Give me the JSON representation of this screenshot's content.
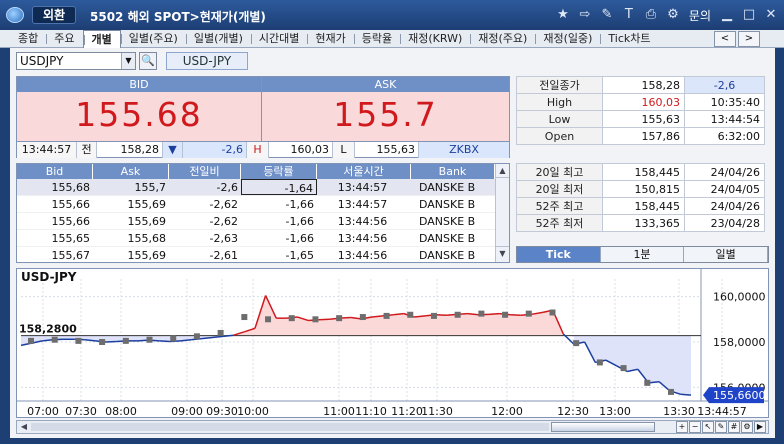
{
  "titlebar": {
    "badge": "외환",
    "title": "5502 해외 SPOT>현재가(개별)",
    "help_label": "문의",
    "icons": [
      "star-icon",
      "export-icon",
      "tool-icon",
      "text-icon",
      "print-icon",
      "settings-icon",
      "minimize-icon",
      "maximize-icon",
      "close-icon"
    ]
  },
  "tabs": [
    {
      "label": "종합"
    },
    {
      "label": "주요"
    },
    {
      "label": "개별",
      "active": true
    },
    {
      "label": "일별(주요)"
    },
    {
      "label": "일별(개별)"
    },
    {
      "label": "시간대별"
    },
    {
      "label": "현재가"
    },
    {
      "label": "등락율"
    },
    {
      "label": "재정(KRW)"
    },
    {
      "label": "재정(주요)"
    },
    {
      "label": "재정(일중)"
    },
    {
      "label": "Tick차트"
    }
  ],
  "symbol": {
    "code": "USDJPY",
    "name": "USD-JPY"
  },
  "quote": {
    "bid_label": "BID",
    "ask_label": "ASK",
    "bid": "155.68",
    "ask": "155.7",
    "time": "13:44:57",
    "prev_label": "전",
    "prev": "158,28",
    "change_arrow": "▼",
    "change": "-2,6",
    "high_label": "H",
    "high": "160,03",
    "low_label": "L",
    "low": "155,63",
    "bank": "ZKBX"
  },
  "summary": [
    {
      "label": "전일종가",
      "value": "158,28",
      "extra": "-2,6"
    },
    {
      "label": "High",
      "value": "160,03",
      "extra": "10:35:40"
    },
    {
      "label": "Low",
      "value": "155,63",
      "extra": "13:44:54"
    },
    {
      "label": "Open",
      "value": "157,86",
      "extra": "6:32:00"
    }
  ],
  "range": [
    {
      "label": "20일 최고",
      "value": "158,445",
      "date": "24/04/26"
    },
    {
      "label": "20일 최저",
      "value": "150,815",
      "date": "24/04/05"
    },
    {
      "label": "52주 최고",
      "value": "158,445",
      "date": "24/04/26"
    },
    {
      "label": "52주 최저",
      "value": "133,365",
      "date": "23/04/28"
    }
  ],
  "ticks": {
    "headers": [
      "Bid",
      "Ask",
      "전일비",
      "등락률",
      "서울시간",
      "Bank"
    ],
    "rows": [
      [
        "155,68",
        "155,7",
        "-2,6",
        "-1,64",
        "13:44:57",
        "DANSKE B"
      ],
      [
        "155,66",
        "155,69",
        "-2,62",
        "-1,66",
        "13:44:57",
        "DANSKE B"
      ],
      [
        "155,66",
        "155,69",
        "-2,62",
        "-1,66",
        "13:44:56",
        "DANSKE B"
      ],
      [
        "155,65",
        "155,68",
        "-2,63",
        "-1,66",
        "13:44:56",
        "DANSKE B"
      ],
      [
        "155,67",
        "155,69",
        "-2,61",
        "-1,65",
        "13:44:56",
        "DANSKE B"
      ]
    ]
  },
  "periods": [
    {
      "label": "Tick",
      "active": true
    },
    {
      "label": "1분"
    },
    {
      "label": "일별"
    }
  ],
  "colors": {
    "up": "#d0191d",
    "down": "#1c3f9f",
    "header": "#6f8fc7"
  },
  "chart_data": {
    "type": "line",
    "title": "USD-JPY",
    "reference": 158.28,
    "reference_label": "158,2800",
    "current": 155.66,
    "current_label": "155,6600",
    "ylim": [
      155.4,
      160.6
    ],
    "yticks": [
      156.0,
      158.0,
      160.0
    ],
    "ytick_labels": [
      "156,0000",
      "158,0000",
      "160,0000"
    ],
    "xticks": [
      "07:00",
      "07:30",
      "08:00",
      "09:00",
      "09:30",
      "10:00",
      "11:00",
      "11:10",
      "11:20",
      "11:30",
      "12:00",
      "12:30",
      "13:00",
      "13:30",
      "13:44:57"
    ],
    "series": [
      {
        "values": [
          157.85,
          157.95,
          158.05,
          158.1,
          158.12,
          158.12,
          158.1,
          158.05,
          158.0,
          158.02,
          158.05,
          158.05,
          158.08,
          158.05,
          158.02,
          158.05,
          158.1,
          158.15,
          158.2,
          158.25,
          158.3,
          158.45,
          158.6,
          160.05,
          159.05,
          159.05,
          159.1,
          158.95,
          158.98,
          159.0,
          159.05,
          159.08,
          159.02,
          159.1,
          159.15,
          159.2,
          159.25,
          159.1,
          159.15,
          159.2,
          159.18,
          159.22,
          159.25,
          159.2,
          159.22,
          159.25,
          159.2,
          159.18,
          159.22,
          159.3,
          159.4,
          158.35,
          157.9,
          158.0,
          157.1,
          157.2,
          156.95,
          156.7,
          156.8,
          156.2,
          156.25,
          155.85,
          155.7,
          155.66
        ]
      }
    ],
    "markers": [
      158.05,
      158.1,
      158.05,
      158.0,
      158.05,
      158.1,
      158.15,
      158.25,
      158.4,
      159.1,
      159.0,
      159.05,
      159.0,
      159.05,
      159.1,
      159.15,
      159.2,
      159.15,
      159.2,
      159.25,
      159.2,
      159.25,
      159.3,
      157.95,
      157.1,
      156.85,
      156.2,
      155.8
    ]
  }
}
